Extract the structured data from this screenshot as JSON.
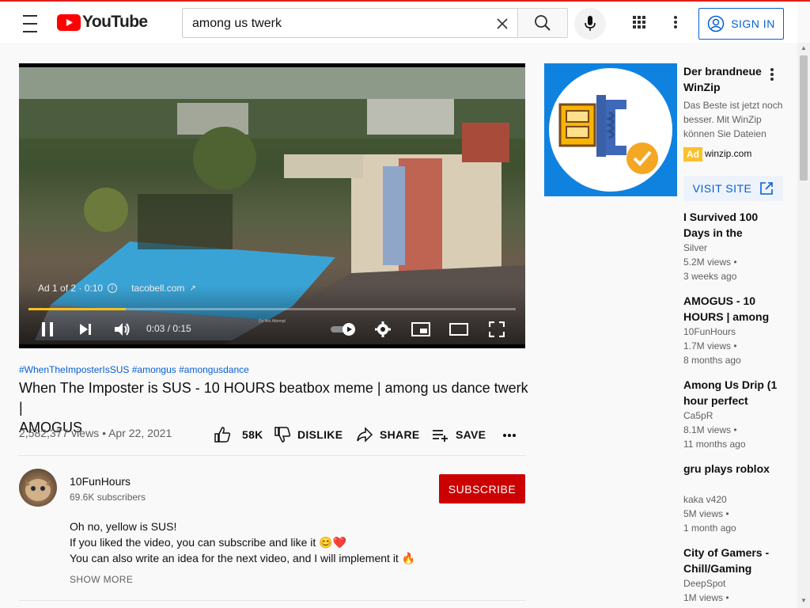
{
  "masthead": {
    "logo_text": "YouTube",
    "search_value": "among us twerk",
    "signin_label": "SIGN IN"
  },
  "player": {
    "ad_info": "Ad 1 of 2 · 0:10",
    "ad_domain": "tacobell.com",
    "small_label": "Do Not Attempt",
    "time": "0:03 / 0:15",
    "progress_fraction": 0.2
  },
  "video": {
    "hashtags": "#WhenTheImposterIsSUS #amongus #amongusdance",
    "title_line1": "When The Imposter is SUS - 10 HOURS beatbox meme | among us dance twerk |",
    "title_line2": "AMOGUS",
    "views_date": "2,582,377 views • Apr 22, 2021",
    "like_count": "58K",
    "dislike_label": "DISLIKE",
    "share_label": "SHARE",
    "save_label": "SAVE"
  },
  "channel": {
    "name": "10FunHours",
    "subscribers": "69.6K subscribers",
    "subscribe_label": "SUBSCRIBE"
  },
  "description": {
    "line1": "Oh no, yellow is SUS!",
    "line2": "If you liked the video, you can subscribe and like it 😊❤️",
    "line3": "You can also write an idea for the next video, and I will implement it 🔥",
    "show_more": "SHOW MORE"
  },
  "ad": {
    "title": "Der brandneue WinZip",
    "description": "Das Beste ist jetzt noch besser. Mit WinZip können Sie Dateien",
    "badge": "Ad",
    "domain": "winzip.com",
    "visit_label": "VISIT SITE"
  },
  "related": [
    {
      "title": "I Survived 100 Days in the",
      "channel": "Silver",
      "views": "5.2M views •",
      "age": "3 weeks ago"
    },
    {
      "title": "AMOGUS - 10 HOURS | among",
      "channel": "10FunHours",
      "views": "1.7M views •",
      "age": "8 months ago"
    },
    {
      "title": "Among Us Drip (1 hour perfect",
      "channel": "Ca5pR",
      "views": "8.1M views •",
      "age": "11 months ago"
    },
    {
      "title": "gru plays roblox",
      "channel": "kaka v420",
      "views": "5M views •",
      "age": "1 month ago"
    },
    {
      "title": "City of Gamers - Chill/Gaming",
      "channel": "DeepSpot",
      "views": "1M views •",
      "age": ""
    }
  ],
  "colors": {
    "brand_red": "#ff0000",
    "link_blue": "#065fd4",
    "subscribe_red": "#cc0000",
    "progress_yellow": "#f7c21a"
  }
}
